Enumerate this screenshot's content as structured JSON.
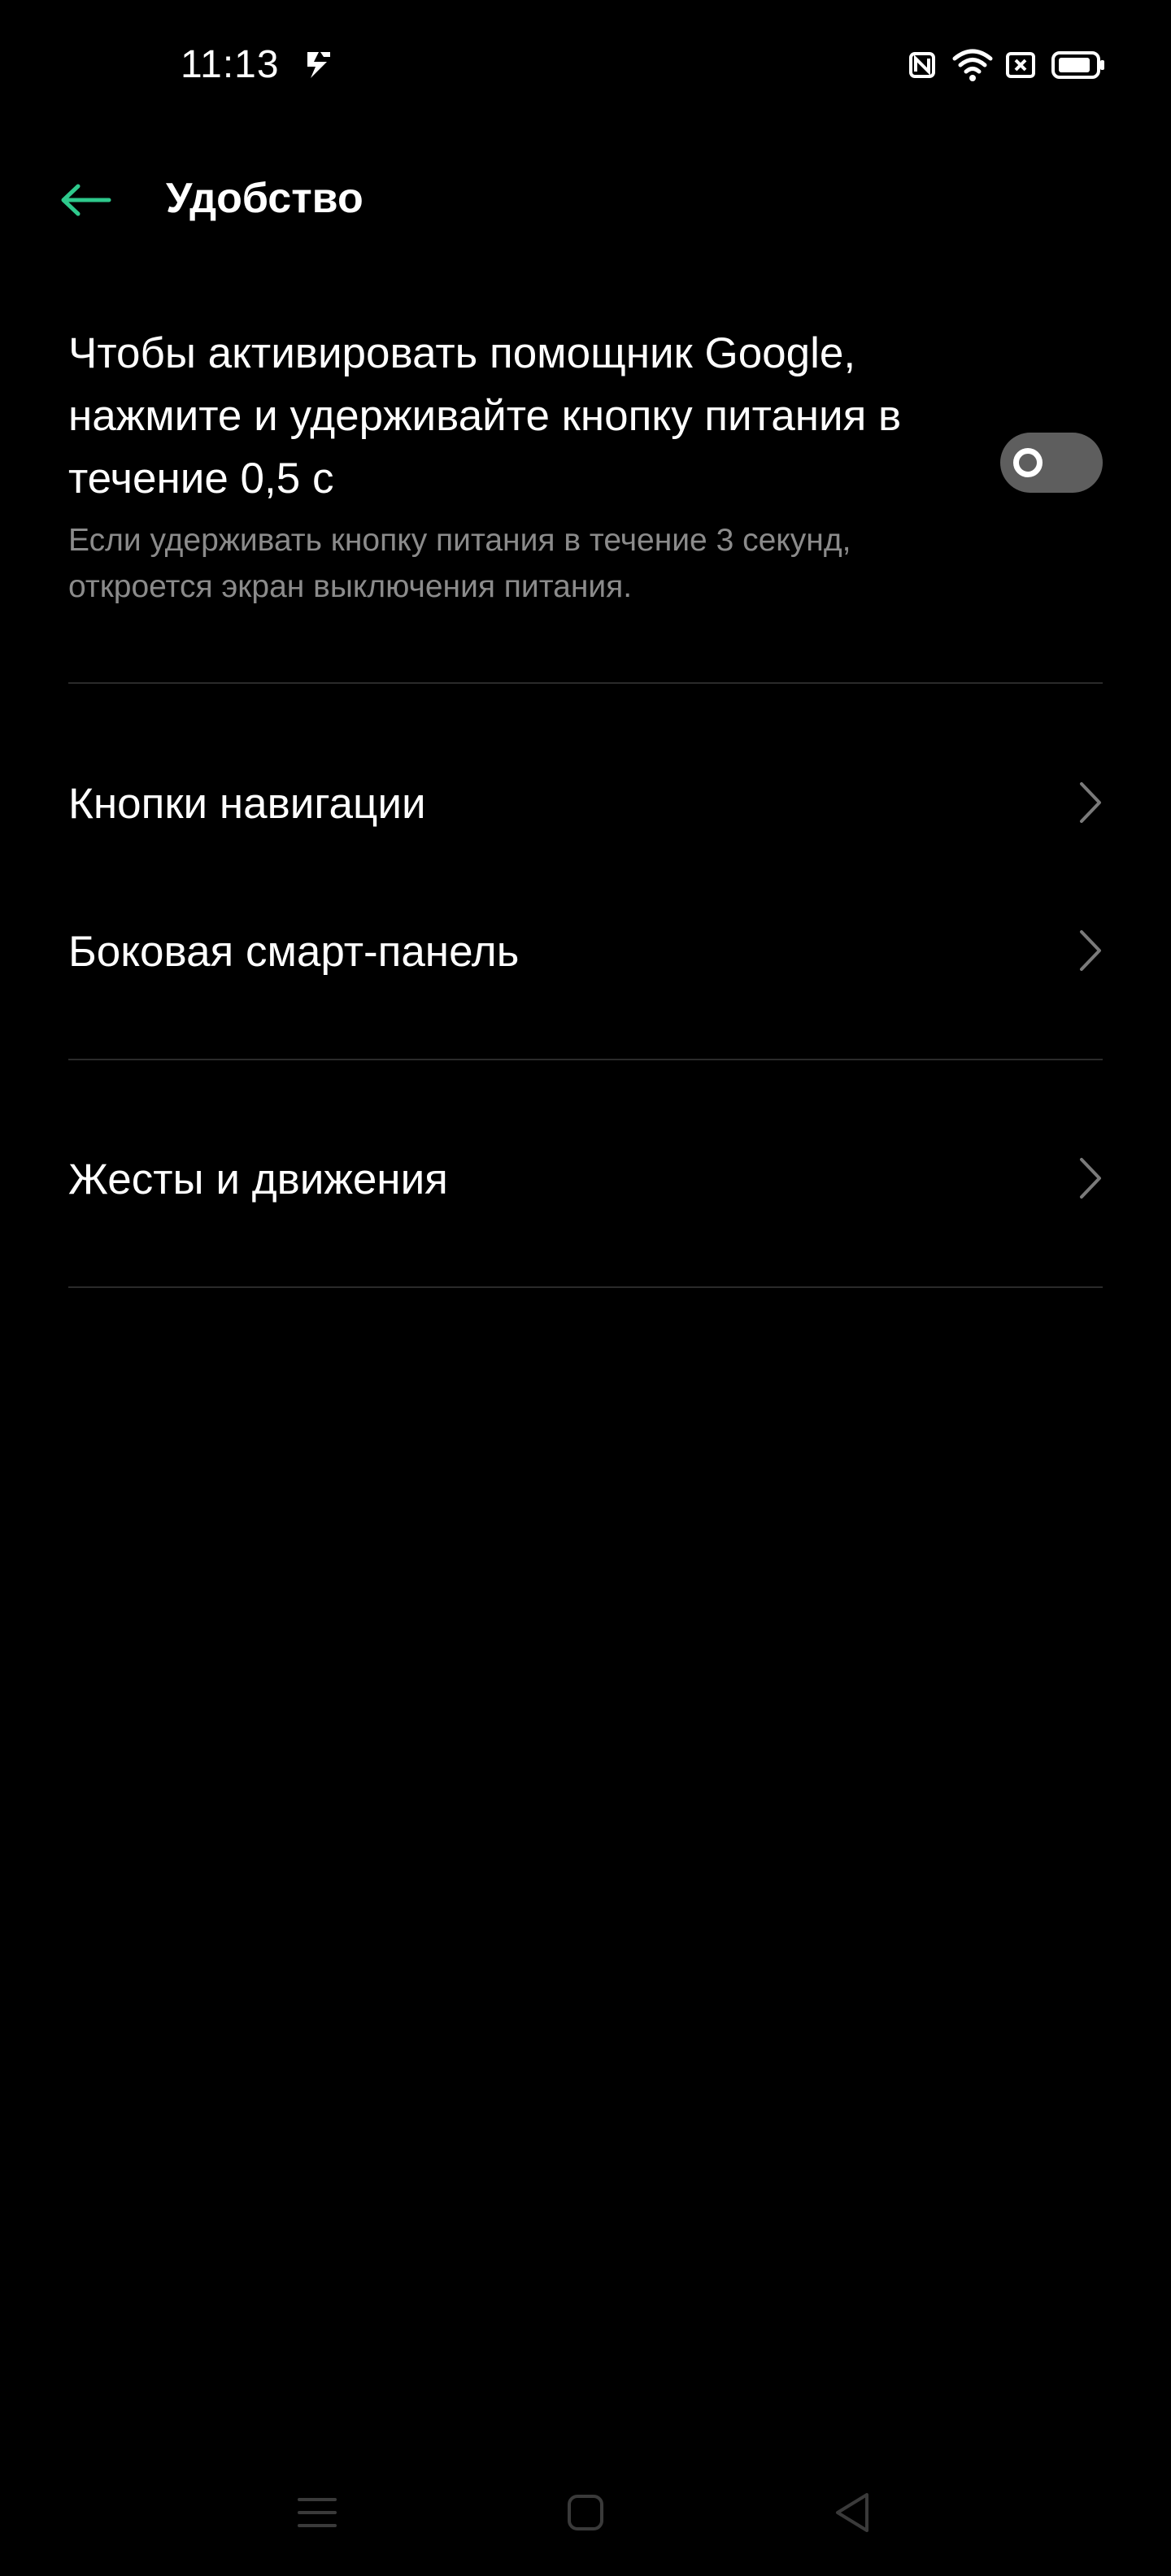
{
  "status_bar": {
    "time": "11:13",
    "icons": [
      "app-notification-icon",
      "nfc-icon",
      "wifi-icon",
      "sim-card-icon",
      "battery-icon"
    ]
  },
  "header": {
    "back_icon": "arrow-left-icon",
    "title": "Удобство"
  },
  "google_assistant_setting": {
    "title": "Чтобы активировать помощник Google, нажмите и удерживайте кнопку питания в течение 0,5 с",
    "summary": "Если удерживать кнопку питания в течение 3 секунд, откроется экран выключения питания.",
    "toggle_on": false
  },
  "menu": {
    "items": [
      {
        "label": "Кнопки навигации",
        "icon": "chevron-right-icon"
      },
      {
        "label": "Боковая смарт-панель",
        "icon": "chevron-right-icon"
      },
      {
        "label": "Жесты и движения",
        "icon": "chevron-right-icon"
      }
    ]
  },
  "system_nav": {
    "buttons": [
      "menu-icon",
      "home-icon",
      "back-triangle-icon"
    ]
  },
  "colors": {
    "background": "#000000",
    "accent": "#2ec98c",
    "text_primary": "#ffffff",
    "text_secondary": "#8b8b8b",
    "divider": "#2a2a2a",
    "toggle_off": "#5e5e5e"
  }
}
